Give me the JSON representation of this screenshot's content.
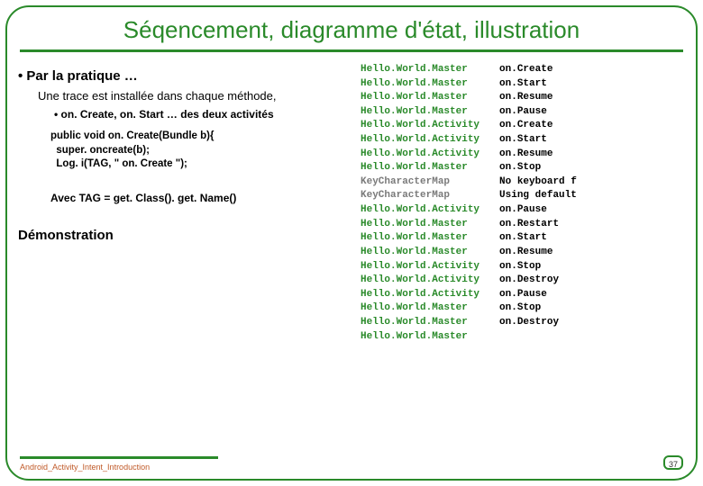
{
  "title": "Séqencement, diagramme d'état, illustration",
  "heading": "Par la pratique …",
  "subheading": "Une trace est installée dans chaque méthode,",
  "bullet2": "on. Create, on. Start … des deux activités",
  "code": {
    "l1": "public void on. Create(Bundle b){",
    "l2": "  super. oncreate(b);",
    "l3": "  Log. i(TAG, \" on. Create \");"
  },
  "tagline": "Avec TAG = get. Class(). get. Name()",
  "demo": "Démonstration",
  "log": {
    "col1": [
      {
        "t": "Hello.World.Master",
        "c": "green"
      },
      {
        "t": "Hello.World.Master",
        "c": "green"
      },
      {
        "t": "Hello.World.Master",
        "c": "green"
      },
      {
        "t": "Hello.World.Master",
        "c": "green"
      },
      {
        "t": "Hello.World.Activity",
        "c": "green"
      },
      {
        "t": "Hello.World.Activity",
        "c": "green"
      },
      {
        "t": "Hello.World.Activity",
        "c": "green"
      },
      {
        "t": "Hello.World.Master",
        "c": "green"
      },
      {
        "t": "KeyCharacterMap",
        "c": "gray"
      },
      {
        "t": "KeyCharacterMap",
        "c": "gray"
      },
      {
        "t": "Hello.World.Activity",
        "c": "green"
      },
      {
        "t": "Hello.World.Master",
        "c": "green"
      },
      {
        "t": "Hello.World.Master",
        "c": "green"
      },
      {
        "t": "Hello.World.Master",
        "c": "green"
      },
      {
        "t": "Hello.World.Activity",
        "c": "green"
      },
      {
        "t": "Hello.World.Activity",
        "c": "green"
      },
      {
        "t": "Hello.World.Activity",
        "c": "green"
      },
      {
        "t": "Hello.World.Master",
        "c": "green"
      },
      {
        "t": "Hello.World.Master",
        "c": "green"
      },
      {
        "t": "Hello.World.Master",
        "c": "green"
      }
    ],
    "col2": [
      "on.Create",
      "on.Start",
      "on.Resume",
      "on.Pause",
      "on.Create",
      "on.Start",
      "on.Resume",
      "on.Stop",
      "No keyboard f",
      "Using default",
      "on.Pause",
      "on.Restart",
      "on.Start",
      "on.Resume",
      "on.Stop",
      "on.Destroy",
      "on.Pause",
      "on.Stop",
      "on.Destroy"
    ]
  },
  "footer": "Android_Activity_Intent_Introduction",
  "page": "37"
}
